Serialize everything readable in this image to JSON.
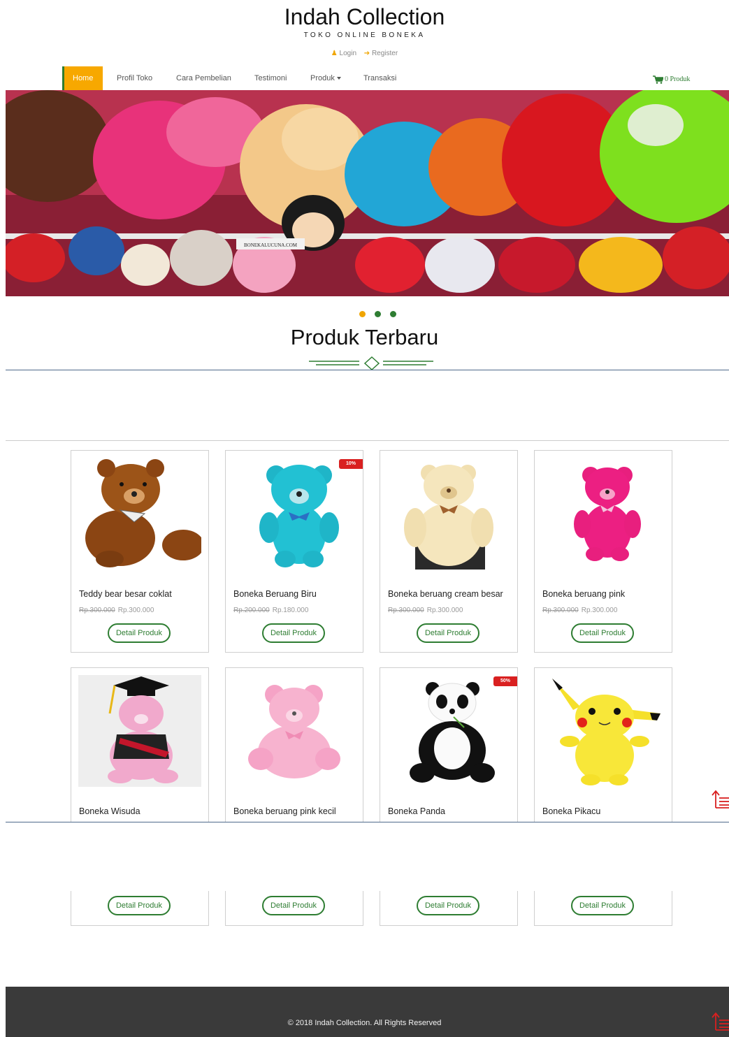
{
  "header": {
    "brand": "Indah Collection",
    "tagline": "TOKO ONLINE BONEKA",
    "login_label": "Login",
    "register_label": "Register"
  },
  "nav": {
    "items": [
      {
        "label": "Home",
        "active": true
      },
      {
        "label": "Profil Toko"
      },
      {
        "label": "Cara Pembelian"
      },
      {
        "label": "Testimoni"
      },
      {
        "label": "Produk"
      },
      {
        "label": "Transaksi"
      }
    ],
    "cart_label": "0 Produk"
  },
  "hero": {
    "image_label": "BONEKALUCUNA.COM",
    "slides": 3,
    "active_slide": 0
  },
  "section": {
    "title": "Produk Terbaru"
  },
  "products": [
    {
      "name": "Teddy bear besar coklat",
      "old_price": "Rp.300.000",
      "price": "Rp.300.000",
      "button": "Detail Produk",
      "badge": ""
    },
    {
      "name": "Boneka Beruang Biru",
      "old_price": "Rp.200.000",
      "price": "Rp.180.000",
      "button": "Detail Produk",
      "badge": "10%"
    },
    {
      "name": "Boneka beruang cream besar",
      "old_price": "Rp.300.000",
      "price": "Rp.300.000",
      "button": "Detail Produk",
      "badge": ""
    },
    {
      "name": "Boneka beruang pink",
      "old_price": "Rp.300.000",
      "price": "Rp.300.000",
      "button": "Detail Produk",
      "badge": ""
    },
    {
      "name": "Boneka Wisuda",
      "button": "Detail Produk",
      "badge": ""
    },
    {
      "name": "Boneka beruang pink kecil",
      "button": "Detail Produk",
      "badge": ""
    },
    {
      "name": "Boneka Panda",
      "button": "Detail Produk",
      "badge": "50%"
    },
    {
      "name": "Boneka Pikacu",
      "button": "Detail Produk",
      "badge": ""
    }
  ],
  "footer": {
    "text": "© 2018 Indah Collection. All Rights Reserved"
  },
  "colors": {
    "accent": "#f7a800",
    "brand_green": "#2e7d32",
    "badge_red": "#d92020",
    "footer_bg": "#3a3a3a"
  }
}
